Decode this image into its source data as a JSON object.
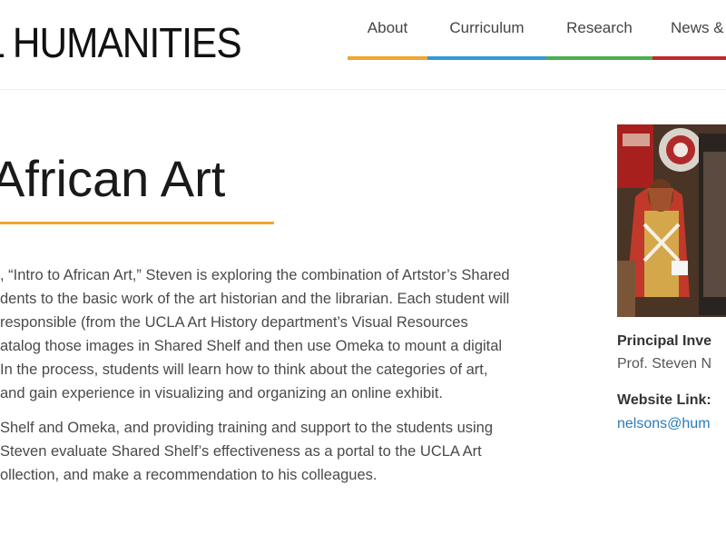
{
  "header": {
    "logo_text": "L HUMANITIES",
    "nav": [
      {
        "label": "About",
        "color": "#f0a530"
      },
      {
        "label": "Curriculum",
        "color": "#2f9bd6"
      },
      {
        "label": "Research",
        "color": "#4caf50"
      },
      {
        "label": "News &",
        "color": "#c0272d"
      }
    ]
  },
  "main": {
    "title": "African Art",
    "paragraphs": [
      [
        ", “Intro to African Art,” Steven is exploring the combination of Artstor’s Shared",
        "dents to the basic work of the art historian and the librarian. Each student will",
        "responsible (from the UCLA Art History department’s Visual Resources",
        "atalog those images in Shared Shelf and then use Omeka to mount a digital",
        " In the process, students will learn how to think about the categories of art,",
        "and gain experience in visualizing and organizing an online exhibit."
      ],
      [
        "Shelf and Omeka, and providing training and support to the students using",
        "Steven evaluate Shared Shelf’s effectiveness as a portal to the UCLA Art",
        "ollection, and make a recommendation to his colleagues."
      ]
    ]
  },
  "sidebar": {
    "pi_label": "Principal Inve",
    "pi_value": "Prof. Steven N",
    "website_label": "Website Link:",
    "website_value": "nelsons@hum"
  }
}
